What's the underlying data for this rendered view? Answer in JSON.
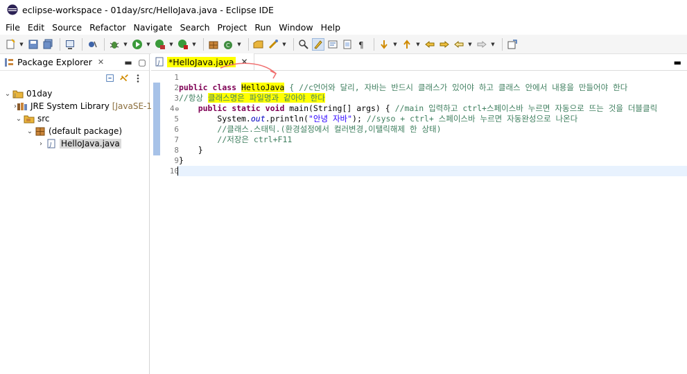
{
  "window": {
    "title": "eclipse-workspace - 01day/src/HelloJava.java - Eclipse IDE"
  },
  "menu": [
    "File",
    "Edit",
    "Source",
    "Refactor",
    "Navigate",
    "Search",
    "Project",
    "Run",
    "Window",
    "Help"
  ],
  "toolbar": {
    "icons": [
      "new-icon",
      "save-icon",
      "save-all-icon",
      "console-icon",
      "skip-breakpoints-icon",
      "debug-icon",
      "run-icon",
      "coverage-icon",
      "external-tools-icon",
      "new-package-icon",
      "new-class-icon",
      "open-type-icon",
      "open-task-icon",
      "search-icon",
      "toggle-mark-occurrences-icon",
      "toggle-breadcrumb-icon",
      "block-selection-icon",
      "show-whitespace-icon",
      "next-annotation-icon",
      "previous-annotation-icon",
      "last-edit-location-icon",
      "back-icon",
      "forward-icon",
      "pin-editor-icon"
    ]
  },
  "explorer": {
    "tab_label": "Package Explorer",
    "tree": [
      {
        "label": "01day",
        "expanded": true,
        "icon": "project-icon",
        "level": 0
      },
      {
        "label": "JRE System Library",
        "decor": "[JavaSE-1",
        "expanded": false,
        "icon": "library-icon",
        "level": 1
      },
      {
        "label": "src",
        "expanded": true,
        "icon": "source-folder-icon",
        "level": 1
      },
      {
        "label": "(default package)",
        "expanded": true,
        "icon": "package-icon",
        "level": 2
      },
      {
        "label": "HelloJava.java",
        "expanded": false,
        "icon": "java-file-icon",
        "level": 3,
        "selected": true
      }
    ]
  },
  "editor": {
    "tab_label": "*HelloJava.java",
    "line_numbers": [
      "1",
      "2",
      "3",
      "4",
      "5",
      "6",
      "7",
      "8",
      "9",
      "10"
    ],
    "code": {
      "l2_kw1": "public",
      "l2_kw2": "class",
      "l2_class": "HelloJava",
      "l2_comment": "{ //c언어와 달리, 자바는 반드시 클래스가 있어야 하고 클래스 안에서 내용을 만들어야 한다",
      "l3_prefix": "//항상 ",
      "l3_highlight": "클래스명은 파일명과 같아야 한다",
      "l4_kw1": "public",
      "l4_kw2": "static",
      "l4_kw3": "void",
      "l4_rest": " main(String[] args) { ",
      "l4_comment": "//main 입력하고 ctrl+스페이스바 누르면 자동으로 뜨는 것을 더블클릭",
      "l5_prefix": "System.",
      "l5_field": "out",
      "l5_call": ".println(",
      "l5_string": "\"안녕 자바\"",
      "l5_end": "); ",
      "l5_comment": "//syso + ctrl+ 스페이스바 누르면 자동완성으로 나온다",
      "l6_comment": "//클래스.스태틱.(환경설정에서 컬러변경,이탤릭해제 한 상태)",
      "l7_comment": "//저장은 ctrl+F11",
      "l8": "}",
      "l9": "}"
    }
  }
}
